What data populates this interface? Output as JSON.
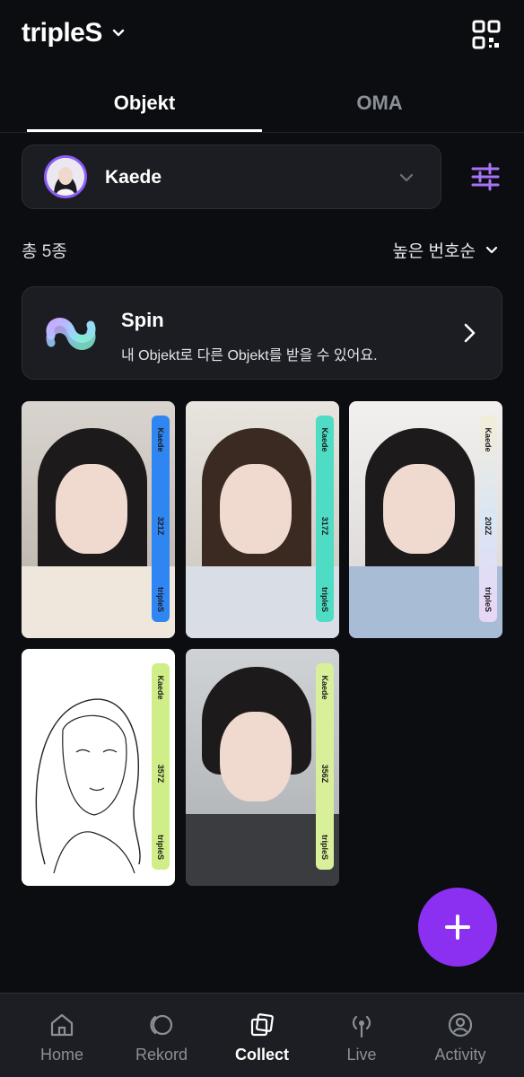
{
  "header": {
    "title": "tripleS",
    "title_chevron_icon": "chevron-down-icon",
    "qr_icon": "qr-code-icon"
  },
  "tabs": [
    {
      "label": "Objekt",
      "active": true
    },
    {
      "label": "OMA",
      "active": false
    }
  ],
  "member_select": {
    "name": "Kaede",
    "avatar_icon": "member-avatar",
    "chevron_icon": "chevron-down-icon"
  },
  "filter_icon": "filter-sliders-icon",
  "summary": {
    "count_text": "총 5종",
    "sort_label": "높은 번호순",
    "sort_icon": "chevron-down-icon"
  },
  "spin": {
    "title": "Spin",
    "description": "내 Objekt로 다른 Objekt를 받을 수 있어요.",
    "icon": "spin-arrows-icon",
    "chevron_icon": "chevron-right-icon"
  },
  "objekts": [
    {
      "member": "Kaede",
      "number": "321Z",
      "group": "tripleS",
      "strip_color": "#2f86f2"
    },
    {
      "member": "Kaede",
      "number": "317Z",
      "group": "tripleS",
      "strip_color": "#4fdcc4"
    },
    {
      "member": "Kaede",
      "number": "202Z",
      "group": "tripleS",
      "strip_color": "#e7dff0"
    },
    {
      "member": "Kaede",
      "number": "357Z",
      "group": "tripleS",
      "strip_color": "#cfee88"
    },
    {
      "member": "Kaede",
      "number": "356Z",
      "group": "tripleS",
      "strip_color": "#d8f09a"
    }
  ],
  "fab": {
    "icon": "plus-icon"
  },
  "bottom_nav": [
    {
      "label": "Home",
      "icon": "home-icon",
      "active": false
    },
    {
      "label": "Rekord",
      "icon": "rekord-icon",
      "active": false
    },
    {
      "label": "Collect",
      "icon": "collect-icon",
      "active": true
    },
    {
      "label": "Live",
      "icon": "live-broadcast-icon",
      "active": false
    },
    {
      "label": "Activity",
      "icon": "activity-user-icon",
      "active": false
    }
  ],
  "colors": {
    "background": "#0c0d10",
    "accent": "#8b2ff0",
    "surface": "#1b1d22",
    "muted_text": "#8b8f98"
  }
}
